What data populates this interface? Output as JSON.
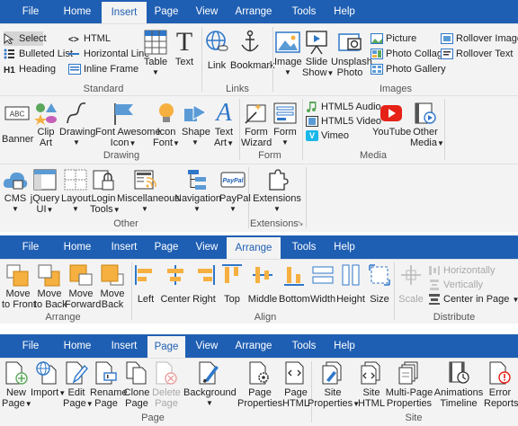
{
  "tabs": [
    "File",
    "Home",
    "Insert",
    "Page",
    "View",
    "Arrange",
    "Tools",
    "Help"
  ],
  "insert": {
    "standard": {
      "label": "Standard",
      "select": "Select",
      "html": "HTML",
      "bulleted_list": "Bulleted List",
      "horizontal_line": "Horizontal Line",
      "heading": "Heading",
      "inline_frame": "Inline Frame",
      "table": "Table",
      "text": "Text"
    },
    "links": {
      "label": "Links",
      "link": "Link",
      "bookmark": "Bookmark"
    },
    "images": {
      "label": "Images",
      "image": "Image",
      "slide_show_1": "Slide",
      "slide_show_2": "Show",
      "unsplash_1": "Unsplash",
      "unsplash_2": "Photo",
      "picture": "Picture",
      "photo_collage": "Photo Collage",
      "photo_gallery": "Photo Gallery",
      "rollover_image": "Rollover Image",
      "rollover_text": "Rollover Text"
    },
    "drawing": {
      "label": "Drawing",
      "banner": "Banner",
      "clip_1": "Clip",
      "clip_2": "Art",
      "drawing": "Drawing",
      "fa_1": "Font Awesome",
      "fa_2": "Icon",
      "icon_font_1": "Icon",
      "icon_font_2": "Font",
      "shape": "Shape",
      "text_art_1": "Text",
      "text_art_2": "Art"
    },
    "form": {
      "label": "Form",
      "wizard_1": "Form",
      "wizard_2": "Wizard",
      "form": "Form"
    },
    "media": {
      "label": "Media",
      "html5_audio": "HTML5 Audio",
      "html5_video": "HTML5 Video",
      "vimeo": "Vimeo",
      "youtube": "YouTube",
      "other_1": "Other",
      "other_2": "Media"
    },
    "other": {
      "label": "Other",
      "cms": "CMS",
      "jquery_1": "jQuery",
      "jquery_2": "UI",
      "layout": "Layout",
      "login_1": "Login",
      "login_2": "Tools",
      "misc": "Miscellaneous",
      "navigation": "Navigation",
      "paypal": "PayPal"
    },
    "extensions": {
      "label": "Extensions",
      "button": "Extensions"
    }
  },
  "arrange": {
    "arrange_group": {
      "label": "Arrange",
      "front_1": "Move",
      "front_2": "to Front",
      "back_1": "Move",
      "back_2": "to Back",
      "forward_1": "Move",
      "forward_2": "Forward",
      "backward_1": "Move",
      "backward_2": "Back"
    },
    "align": {
      "label": "Align",
      "left": "Left",
      "center": "Center",
      "right": "Right",
      "top": "Top",
      "middle": "Middle",
      "bottom": "Bottom",
      "width": "Width",
      "height": "Height",
      "size": "Size"
    },
    "distribute": {
      "label": "Distribute",
      "scale": "Scale",
      "horizontally": "Horizontally",
      "vertically": "Vertically",
      "center_in_page": "Center in Page"
    }
  },
  "page": {
    "page_group": {
      "label": "Page",
      "new_1": "New",
      "new_2": "Page",
      "import": "Import",
      "edit_1": "Edit",
      "edit_2": "Page",
      "rename_1": "Rename",
      "rename_2": "Page",
      "clone_1": "Clone",
      "clone_2": "Page",
      "delete_1": "Delete",
      "delete_2": "Page",
      "background": "Background",
      "props_1": "Page",
      "props_2": "Properties",
      "html_1": "Page",
      "html_2": "HTML"
    },
    "site_group": {
      "label": "Site",
      "site_props_1": "Site",
      "site_props_2": "Properties",
      "site_html_1": "Site",
      "site_html_2": "HTML",
      "multi_1": "Multi-Page",
      "multi_2": "Properties",
      "anim_1": "Animations",
      "anim_2": "Timeline",
      "errors_1": "Error",
      "errors_2": "Reports"
    }
  },
  "colors": {
    "tabbar": "#1f5fb3",
    "ribbon": "#f3f3f3",
    "accent_orange": "#f5b040",
    "icon_blue": "#2f77c9"
  }
}
